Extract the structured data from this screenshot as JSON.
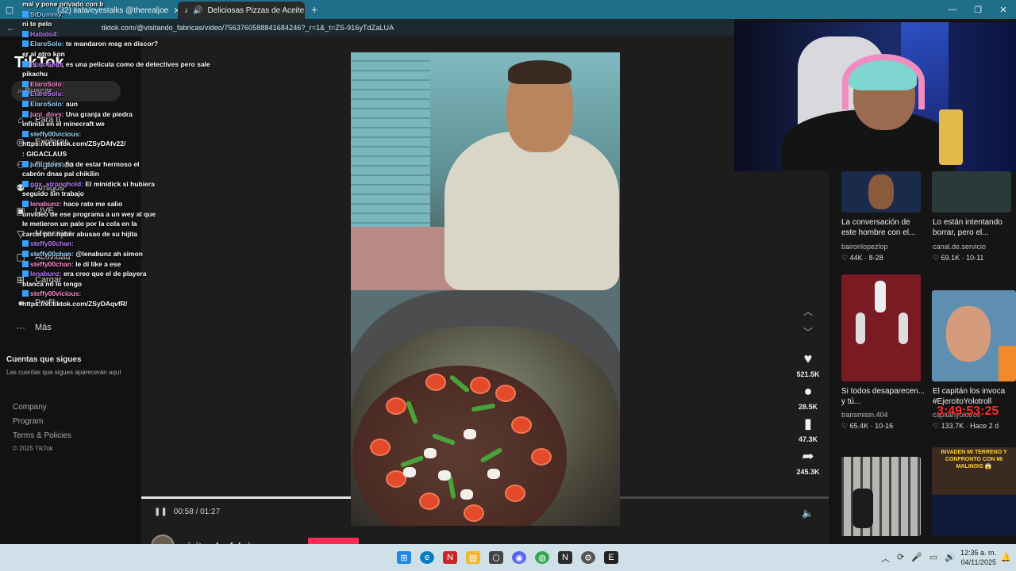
{
  "browser": {
    "tabs": [
      {
        "label": "(32) ilafa/eyestalks @therealjoe",
        "close": "✕"
      },
      {
        "label": "Deliciosas Pizzas de Aceite d",
        "close": "✕"
      }
    ],
    "new_tab": "+",
    "url": "tiktok.com/@visitando_fabricas/video/7563760588841684246?_r=1&_t=ZS-916yTdZaLUA"
  },
  "sidebar": {
    "logo": "TikTok",
    "search_placeholder": "Buscar",
    "nav": [
      {
        "label": "Para ti",
        "icon": "home-icon"
      },
      {
        "label": "Explorar",
        "icon": "compass-icon"
      },
      {
        "label": "Siguiendo",
        "icon": "following-icon"
      },
      {
        "label": "Amigos",
        "icon": "friends-icon"
      },
      {
        "label": "LIVE",
        "icon": "live-icon"
      },
      {
        "label": "Mensajes",
        "icon": "messages-icon"
      },
      {
        "label": "Actividad",
        "icon": "activity-icon"
      },
      {
        "label": "Cargar",
        "icon": "upload-icon"
      },
      {
        "label": "Perfil",
        "icon": "profile-icon"
      },
      {
        "label": "Más",
        "icon": "more-icon"
      }
    ],
    "following_title": "Cuentas que sigues",
    "following_sub": "Las cuentas que sigues aparecerán aquí",
    "footer": {
      "company": "Company",
      "program": "Program",
      "terms": "Terms & Policies",
      "copyright": "© 2025 TikTok"
    }
  },
  "video": {
    "time": "00:58 / 01:27",
    "progress": 0.667,
    "author": "visitando_fabricas",
    "likes": "521.5K",
    "comments": "28.5K",
    "saves": "47.3K",
    "shares": "245.3K"
  },
  "related": [
    {
      "title": "La conversación de este hombre con el...",
      "user": "baironlopezlop",
      "meta": "♡ 44K · 8-28"
    },
    {
      "title": "Lo están intentando borrar, pero el...",
      "user": "canal.de.servicio",
      "meta": "♡ 69.1K · 10-11"
    },
    {
      "title": "Si todos desaparecen... y tú...",
      "user": "transmisin.404",
      "meta": "♡ 65.4K · 10-16"
    },
    {
      "title": "El capitán los invoca #EjercitoYolotroll",
      "user": "capitanyolotroll",
      "meta": "♡ 133.7K · Hace 2 d"
    },
    {
      "thumb_text": "INVADEN MI TERRENO Y CONFRONTO CON MI MALINOIS 😱"
    }
  ],
  "overlay": {
    "timer": "3:49:53:25"
  },
  "chat": [
    {
      "user": "",
      "text": "mal y pone privado con b"
    },
    {
      "user": "StDummy:",
      "text": ""
    },
    {
      "user": "",
      "text": "ni te pelo"
    },
    {
      "user": "Habido4:",
      "text": ""
    },
    {
      "user": "ElaroSolo:",
      "text": "te mandaron msg en discor?"
    },
    {
      "user": "",
      "text": "er al otro kon"
    },
    {
      "user": "ElaroSolo:",
      "text": "es una pelicula como de detectives pero sale"
    },
    {
      "user": "",
      "text": "pikachu"
    },
    {
      "user": "ElaroSolo:",
      "text": ""
    },
    {
      "user": "ElaroSolo:",
      "text": ""
    },
    {
      "user": "ElaroSolo:",
      "text": "aun"
    },
    {
      "user": "juni_dovs:",
      "text": "Una granja de piedra"
    },
    {
      "user": "",
      "text": "infinita en el minecraft we"
    },
    {
      "user": "steffy00vicious:",
      "text": ""
    },
    {
      "user": "",
      "text": "https://vt.tiktok.com/ZSyDAfv22/"
    },
    {
      "user": "",
      "text": ": GIGACLAUS"
    },
    {
      "user": "juni_dovs:",
      "text": "ha de estar hermoso el"
    },
    {
      "user": "",
      "text": "cabrón dnas pal chikilin"
    },
    {
      "user": "ggx_stronghold:",
      "text": "El minidick si hubiera"
    },
    {
      "user": "",
      "text": "seguido sin trabajo"
    },
    {
      "user": "lenabunz:",
      "text": "hace rato me salio"
    },
    {
      "user": "",
      "text": "unvideo de ese programa a un wey al que"
    },
    {
      "user": "",
      "text": "le metieron un palo por la cola en la"
    },
    {
      "user": "",
      "text": "carcel por haber abusao de su hijita"
    },
    {
      "user": "steffy00chan:",
      "text": ""
    },
    {
      "user": "steffy00chan:",
      "text": "@lenabunz ah simon"
    },
    {
      "user": "steffy00chan:",
      "text": "le di like a ese"
    },
    {
      "user": "lenabunz:",
      "text": "era creo que el de playera"
    },
    {
      "user": "",
      "text": "blanca  no lo tengo"
    },
    {
      "user": "steffy00vicious:",
      "text": ""
    },
    {
      "user": "",
      "text": "https://vt.tiktok.com/ZSyDAqvfR/"
    }
  ],
  "taskbar": {
    "time": "12:35 a. m.",
    "date": "04/11/2025"
  },
  "colors": {
    "accent": "#fe2c55",
    "taskbar": "#cfe0e8",
    "titlebar": "#1f6f8b"
  }
}
